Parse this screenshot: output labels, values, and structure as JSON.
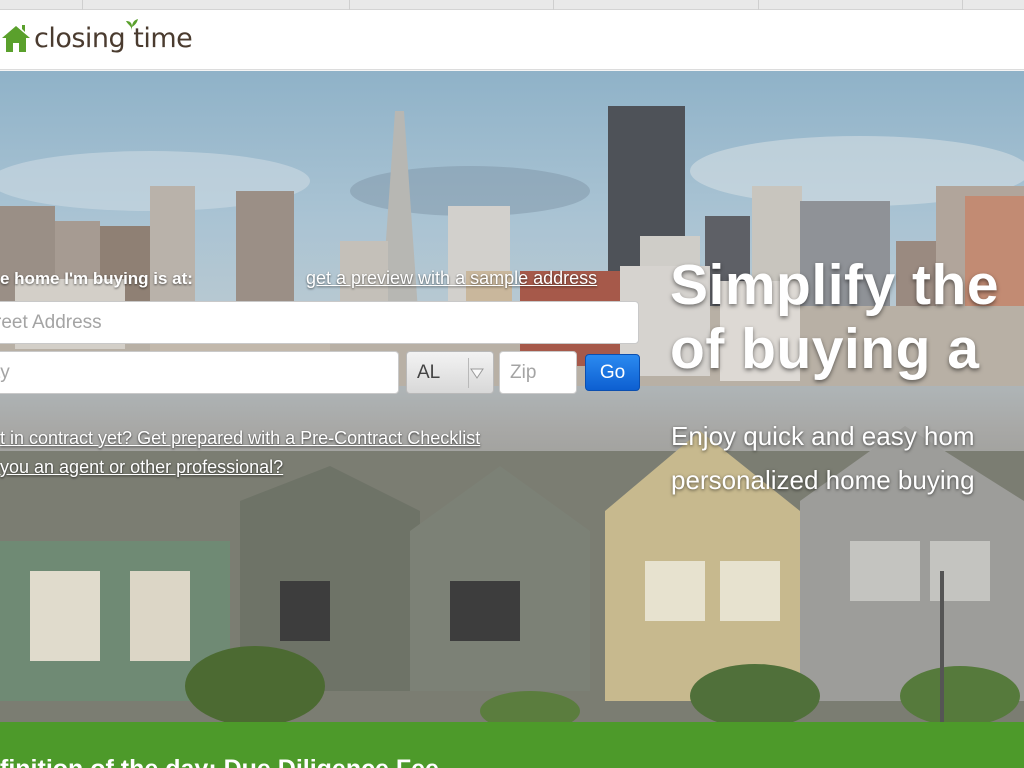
{
  "header": {
    "brand": "closing time",
    "brand_color": "#4a3b2f",
    "logo_accent": "#5aa02c"
  },
  "form": {
    "address_label": "e home I'm buying is at:",
    "preview_link": "get a preview with a sample address",
    "street_placeholder": "reet Address",
    "city_placeholder": "ty",
    "state_value": "AL",
    "zip_placeholder": "Zip",
    "go_label": "Go"
  },
  "links": {
    "pre_contract": "t in contract yet? Get prepared with a Pre-Contract Checklist",
    "agent": "you an agent or other professional?"
  },
  "hero": {
    "headline_line1": "Simplify the",
    "headline_line2": "of buying a",
    "sub_line1": "Enjoy quick and easy hom",
    "sub_line2": "personalized home buying"
  },
  "footer_bar": {
    "text": "finition of the day: Due Diligence Fee",
    "color": "#4d9a2a"
  },
  "colors": {
    "go_button": "#1a73e8",
    "text_on_hero": "#ffffff"
  }
}
